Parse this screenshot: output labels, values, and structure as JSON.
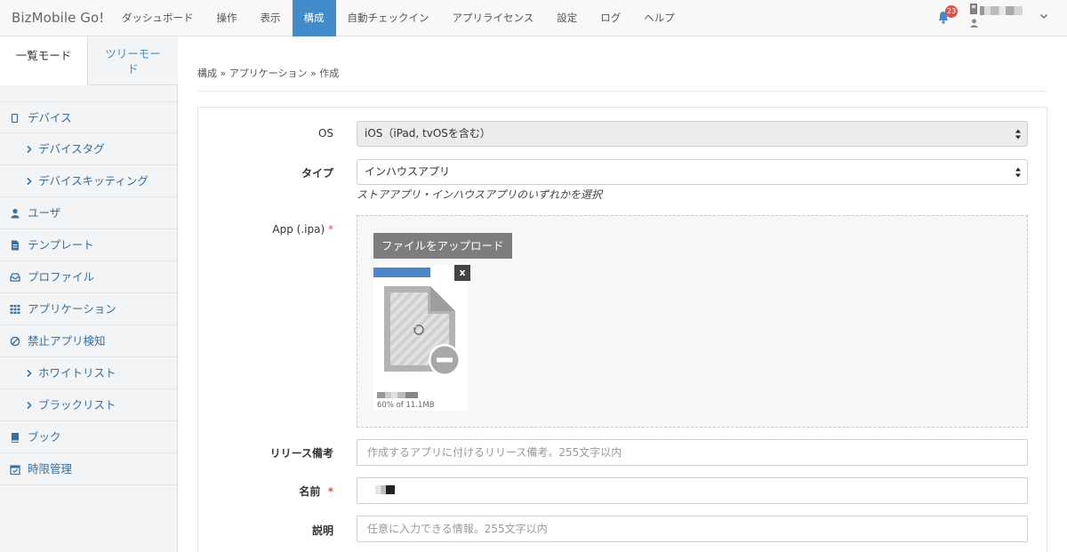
{
  "app": {
    "brand": "BizMobile Go!"
  },
  "nav": {
    "items": [
      {
        "label": "ダッシュボード",
        "active": false
      },
      {
        "label": "操作",
        "active": false
      },
      {
        "label": "表示",
        "active": false
      },
      {
        "label": "構成",
        "active": true
      },
      {
        "label": "自動チェックイン",
        "active": false
      },
      {
        "label": "アプリライセンス",
        "active": false
      },
      {
        "label": "設定",
        "active": false
      },
      {
        "label": "ログ",
        "active": false
      },
      {
        "label": "ヘルプ",
        "active": false
      }
    ],
    "notification_count": "23",
    "accent_color": "#428bca"
  },
  "sidebar": {
    "mode_tabs": [
      {
        "label": "一覧モード",
        "active": true
      },
      {
        "label": "ツリーモード",
        "active": false
      }
    ],
    "items": [
      {
        "label": "デバイス",
        "icon": "device-icon",
        "sub": false
      },
      {
        "label": "デバイスタグ",
        "icon": "chevron-right-icon",
        "sub": true
      },
      {
        "label": "デバイスキッティング",
        "icon": "chevron-right-icon",
        "sub": true
      },
      {
        "label": "ユーザ",
        "icon": "user-icon",
        "sub": false
      },
      {
        "label": "テンプレート",
        "icon": "file-icon",
        "sub": false
      },
      {
        "label": "プロファイル",
        "icon": "inbox-icon",
        "sub": false
      },
      {
        "label": "アプリケーション",
        "icon": "grid-icon",
        "sub": false
      },
      {
        "label": "禁止アプリ検知",
        "icon": "ban-icon",
        "sub": false
      },
      {
        "label": "ホワイトリスト",
        "icon": "chevron-right-icon",
        "sub": true
      },
      {
        "label": "ブラックリスト",
        "icon": "chevron-right-icon",
        "sub": true
      },
      {
        "label": "ブック",
        "icon": "book-icon",
        "sub": false
      },
      {
        "label": "時限管理",
        "icon": "calendar-icon",
        "sub": false
      }
    ]
  },
  "main": {
    "breadcrumb": "構成 » アプリケーション » 作成",
    "form": {
      "os": {
        "label": "OS",
        "value": "iOS（iPad, tvOSを含む）"
      },
      "type": {
        "label": "タイプ",
        "value": "インハウスアプリ",
        "help": "ストアアプリ・インハウスアプリのいずれかを選択"
      },
      "app": {
        "label": "App (.ipa)",
        "required_mark": "*",
        "upload_button": "ファイルをアップロード",
        "remove_button": "x",
        "progress": 0.6,
        "file_status": "60% of 11.1MB"
      },
      "release_note": {
        "label": "リリース備考",
        "placeholder": "作成するアプリに付けるリリース備考。255文字以内"
      },
      "name": {
        "label": "名前",
        "required_mark": "*"
      },
      "description": {
        "label": "説明",
        "placeholder": "任意に入力できる情報。255文字以内"
      }
    }
  }
}
